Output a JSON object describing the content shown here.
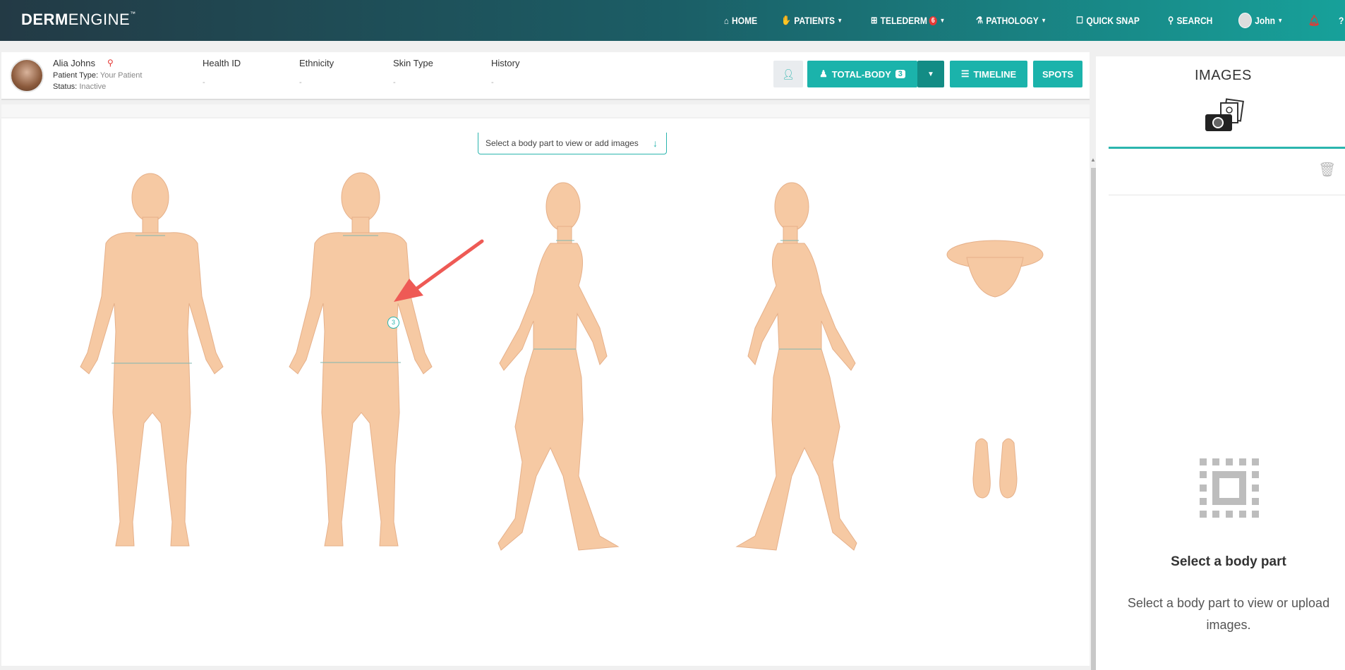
{
  "brand": {
    "strong": "DERM",
    "light": "ENGINE",
    "tm": "™"
  },
  "nav": {
    "home": "HOME",
    "patients": "PATIENTS",
    "telederm": "TELEDERM",
    "telederm_badge": "6",
    "pathology": "PATHOLOGY",
    "quick_snap": "QUICK SNAP",
    "search": "SEARCH",
    "user": "John"
  },
  "patient": {
    "name": "Alia Johns",
    "type_label": "Patient Type:",
    "type_value": "Your Patient",
    "status_label": "Status:",
    "status_value": "Inactive",
    "columns": [
      {
        "label": "Health ID",
        "value": "-"
      },
      {
        "label": "Ethnicity",
        "value": "-"
      },
      {
        "label": "Skin Type",
        "value": "-"
      },
      {
        "label": "History",
        "value": "-"
      }
    ]
  },
  "toolbar": {
    "total_body": "TOTAL-BODY",
    "total_body_count": "3",
    "timeline": "TIMELINE",
    "spots": "SPOTS"
  },
  "bodymap": {
    "hint": "Select a body part to view or add images",
    "spot_count": "3"
  },
  "images_panel": {
    "title": "IMAGES",
    "empty_title": "Select a body part",
    "empty_text": "Select a body part to view or upload images."
  },
  "colors": {
    "accent": "#1bb3ab",
    "skin": "#f6c9a3",
    "alert": "#e53935"
  }
}
